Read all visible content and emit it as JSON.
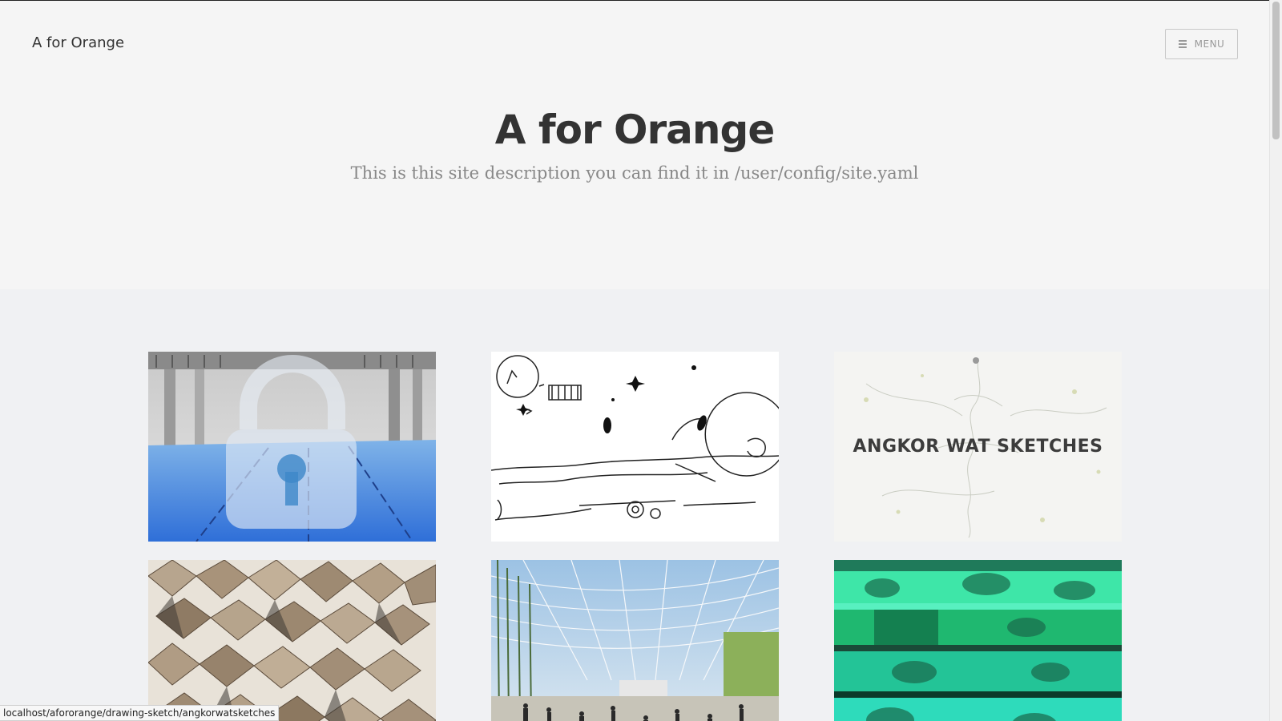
{
  "site": {
    "brand": "A for Orange",
    "menu_label": "MENU",
    "title": "A for Orange",
    "description": "This is this site description you can find it in /user/config/site.yaml"
  },
  "gallery": {
    "tiles": [
      {
        "name": "pool-render",
        "caption": ""
      },
      {
        "name": "line-sketch",
        "caption": ""
      },
      {
        "name": "angkor-wat-sketches",
        "caption": "ANGKOR WAT SKETCHES"
      },
      {
        "name": "folded-panels",
        "caption": ""
      },
      {
        "name": "atrium-render",
        "caption": ""
      },
      {
        "name": "green-glitch-photo",
        "caption": ""
      }
    ]
  },
  "status_bar": {
    "url": "localhost/afororange/drawing-sketch/angkorwatsketches"
  },
  "colors": {
    "background": "#f5f5f5",
    "content_background": "#f0f1f3",
    "text": "#333333",
    "muted": "#888888"
  }
}
